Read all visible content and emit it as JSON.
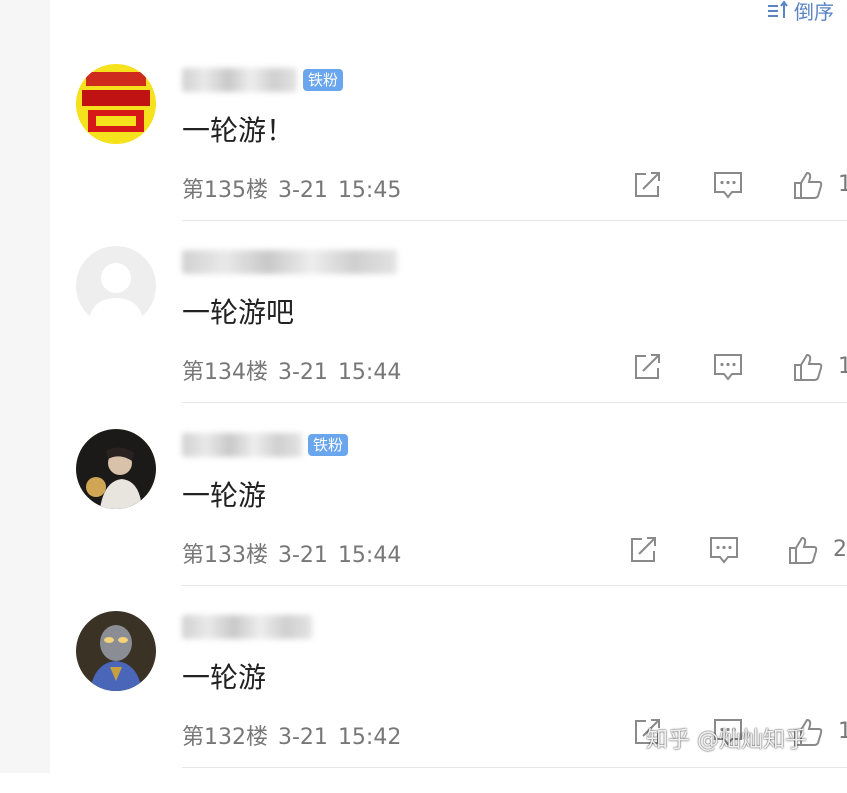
{
  "sort": {
    "label": "倒序",
    "icon": "sort-descending-icon"
  },
  "comments": [
    {
      "name_badge": "铁粉",
      "text": "一轮游！",
      "floor": "第135楼",
      "date": "3-21",
      "time": "15:45",
      "likes": "1"
    },
    {
      "name_badge": "",
      "text": "一轮游吧",
      "floor": "第134楼",
      "date": "3-21",
      "time": "15:44",
      "likes": "1"
    },
    {
      "name_badge": "铁粉",
      "text": "一轮游",
      "floor": "第133楼",
      "date": "3-21",
      "time": "15:44",
      "likes": "2"
    },
    {
      "name_badge": "",
      "text": "一轮游",
      "floor": "第132楼",
      "date": "3-21",
      "time": "15:42",
      "likes": "1"
    }
  ],
  "watermark": "知乎 @灿灿知乎",
  "colors": {
    "accent": "#5b84c4",
    "badge": "#6aa6ee",
    "meta": "#777777"
  }
}
